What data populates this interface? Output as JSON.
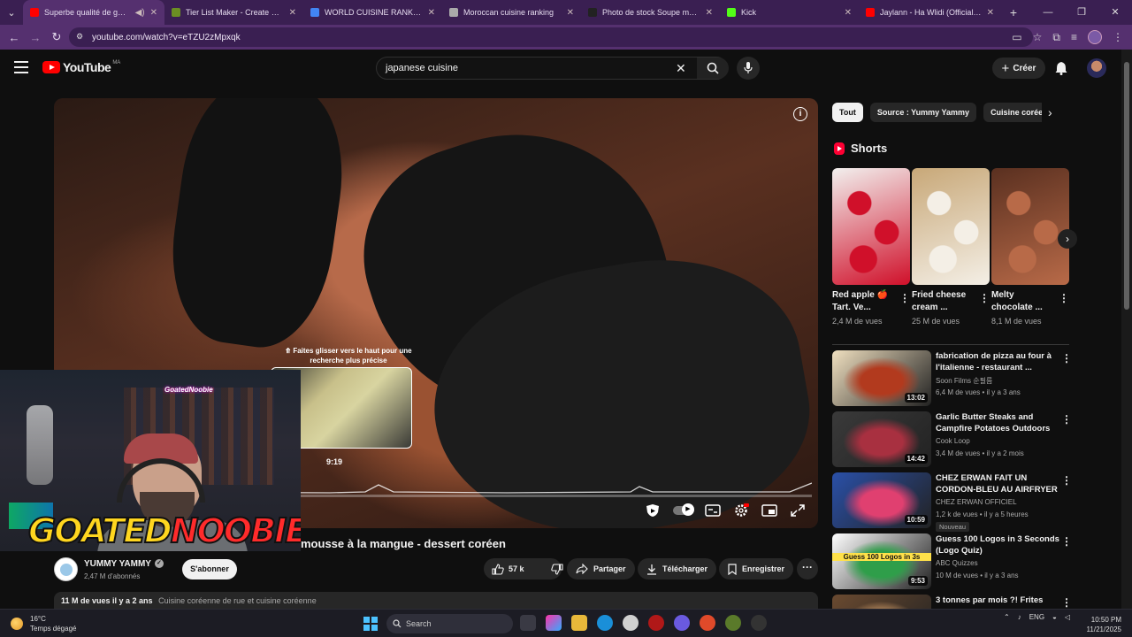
{
  "browser": {
    "tabs": [
      {
        "title": "Superbe qualité de gâteau",
        "active": true,
        "favicon_color": "#ff0000",
        "muted_icon": "speaker-icon"
      },
      {
        "title": "Tier List Maker - Create a Tier L",
        "active": false,
        "favicon_color": "#6b8e23"
      },
      {
        "title": "WORLD CUISINE RANK - Reche",
        "active": false,
        "favicon_color": "#4285f4"
      },
      {
        "title": "Moroccan cuisine ranking",
        "active": false,
        "favicon_color": "#aaaaaa"
      },
      {
        "title": "Photo de stock Soupe marocai",
        "active": false,
        "favicon_color": "#222222"
      },
      {
        "title": "Kick",
        "active": false,
        "favicon_color": "#53fc18"
      },
      {
        "title": "Jaylann - Ha Wlidi (Official Mu",
        "active": false,
        "favicon_color": "#ff0000"
      }
    ],
    "url": "youtube.com/watch?v=eTZU2zMpxqk"
  },
  "youtube": {
    "logo_text": "YouTube",
    "country_code": "MA",
    "search_value": "japanese cuisine",
    "create_label": "Créer"
  },
  "player": {
    "scrub_hint": "Faites glisser vers le haut pour une recherche plus précise",
    "preview_time": "9:19",
    "progress": 0.052
  },
  "overlay": {
    "brand_part1": "GOATED",
    "brand_part2": "NOOBIE",
    "shelf_sign": "GoatedNoobie"
  },
  "video": {
    "title": "mousse à la mangue - dessert coréen",
    "channel": "YUMMY YAMMY",
    "subscribers": "2,47 M d'abonnés",
    "subscribe_label": "S'abonner",
    "likes": "57 k",
    "share_label": "Partager",
    "download_label": "Télécharger",
    "save_label": "Enregistrer",
    "views_date": "11 M de vues  il y a 2 ans",
    "tags": "Cuisine coréenne de rue et cuisine coréenne"
  },
  "chips": [
    "Tout",
    "Source : Yummy Yammy",
    "Cuisine coréenne"
  ],
  "shorts": {
    "heading": "Shorts",
    "items": [
      {
        "title": "Red apple 🍎 Tart. Ve...",
        "views": "2,4 M de vues",
        "c1": "#f2f0ee",
        "c2": "#d0102a"
      },
      {
        "title": "Fried cheese cream ...",
        "views": "25 M de vues",
        "c1": "#c8a878",
        "c2": "#f4efe6"
      },
      {
        "title": "Melty chocolate ...",
        "views": "8,1 M de vues",
        "c1": "#5a3020",
        "c2": "#b86a48"
      }
    ]
  },
  "recommendations": [
    {
      "title": "fabrication de pizza au four à l'italienne - restaurant ...",
      "channel": "Soon Films 순필름",
      "meta": "6,4 M de vues • il y a 3 ans",
      "duration": "13:02",
      "c1": "#f0e0c0",
      "c2": "#b23a1e",
      "badge": ""
    },
    {
      "title": "Garlic Butter Steaks and Campfire Potatoes Outdoors",
      "channel": "Cook Loop",
      "meta": "3,4 M de vues • il y a 2 mois",
      "duration": "14:42",
      "c1": "#3a3a3a",
      "c2": "#a83040",
      "badge": ""
    },
    {
      "title": "CHEZ ERWAN FAIT UN CORDON-BLEU AU AIRFRYER ...",
      "channel": "CHEZ ERWAN OFFICIEL",
      "meta": "1,2 k de vues • il y a 5 heures",
      "duration": "10:59",
      "c1": "#2a50a8",
      "c2": "#e04070",
      "badge": "Nouveau"
    },
    {
      "title": "Guess 100 Logos in 3 Seconds (Logo Quiz)",
      "channel": "ABC Quizzes",
      "meta": "10 M de vues • il y a 3 ans",
      "duration": "9:53",
      "c1": "#ffffff",
      "c2": "#2f9e4a",
      "badge": "",
      "thumb_text": "Guess 100 Logos in 3s"
    },
    {
      "title": "3 tonnes par mois ?! Frites",
      "channel": "",
      "meta": "",
      "duration": "",
      "c1": "#6a4a30",
      "c2": "#c09060",
      "badge": ""
    }
  ],
  "taskbar": {
    "temp": "16°C",
    "weather": "Temps dégagé",
    "search_placeholder": "Search",
    "lang": "ENG",
    "time": "10:50 PM",
    "date": "11/21/2025"
  }
}
